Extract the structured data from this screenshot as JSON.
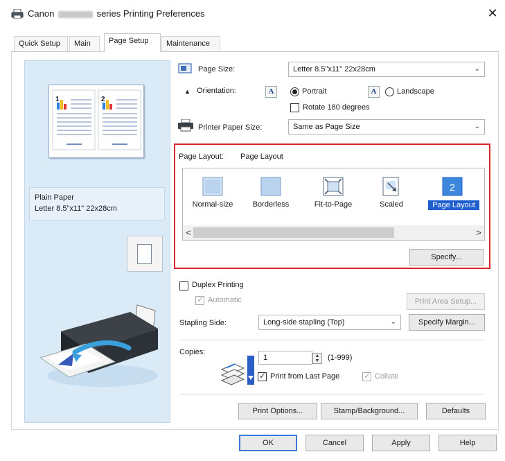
{
  "window": {
    "title_prefix": "Canon",
    "title_suffix": "series Printing Preferences",
    "close_glyph": "✕"
  },
  "tabs": [
    {
      "label": "Quick Setup"
    },
    {
      "label": "Main"
    },
    {
      "label": "Page Setup"
    },
    {
      "label": "Maintenance"
    }
  ],
  "preview": {
    "media_type": "Plain Paper",
    "paper_size": "Letter 8.5\"x11\" 22x28cm",
    "page_numbers": [
      "1",
      "2"
    ]
  },
  "page_size": {
    "label": "Page Size:",
    "value": "Letter 8.5\"x11\" 22x28cm"
  },
  "orientation": {
    "label": "Orientation:",
    "portrait_label": "Portrait",
    "landscape_label": "Landscape",
    "selected": "Portrait",
    "rotate_label": "Rotate 180 degrees",
    "rotate_checked": false
  },
  "printer_paper_size": {
    "label": "Printer Paper Size:",
    "value": "Same as Page Size"
  },
  "page_layout": {
    "label": "Page Layout:",
    "value": "Page Layout",
    "items": [
      {
        "label": "Normal-size"
      },
      {
        "label": "Borderless"
      },
      {
        "label": "Fit-to-Page"
      },
      {
        "label": "Scaled"
      },
      {
        "label": "Page Layout"
      }
    ],
    "selected": "Page Layout",
    "scroll_left": "<",
    "scroll_right": ">",
    "specify_button": "Specify..."
  },
  "duplex": {
    "label": "Duplex Printing",
    "checked": false,
    "automatic_label": "Automatic",
    "automatic_checked": true,
    "print_area_button": "Print Area Setup..."
  },
  "stapling": {
    "label": "Stapling Side:",
    "value": "Long-side stapling (Top)",
    "specify_margin_button": "Specify Margin..."
  },
  "copies": {
    "label": "Copies:",
    "value": "1",
    "range": "(1-999)",
    "print_from_last_label": "Print from Last Page",
    "print_from_last_checked": true,
    "collate_label": "Collate",
    "collate_checked": true
  },
  "bottom_buttons": {
    "print_options": "Print Options...",
    "stamp_background": "Stamp/Background...",
    "defaults": "Defaults"
  },
  "dialog_buttons": {
    "ok": "OK",
    "cancel": "Cancel",
    "apply": "Apply",
    "help": "Help"
  },
  "colors": {
    "selection": "#1f5fd0",
    "highlight_border": "#d9262b",
    "preview_pane": "#dbeaf7"
  }
}
